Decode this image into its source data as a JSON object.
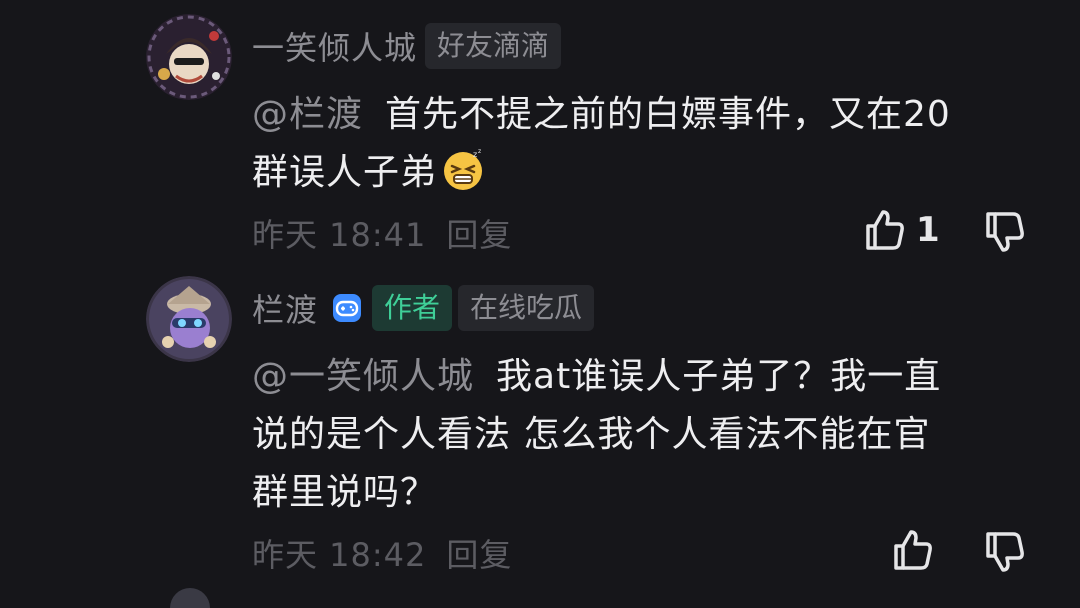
{
  "comments": [
    {
      "username": "一笑倾人城",
      "tags": [
        "好友滴滴"
      ],
      "mention": "@栏渡",
      "text_line1": "首先不提之前的白嫖事件，又在20",
      "text_line2": "群误人子弟",
      "emoji": "tired-face-emoji",
      "time": "昨天 18:41",
      "reply_label": "回复",
      "like_count": "1"
    },
    {
      "username": "栏渡",
      "badge": "game-controller-badge-icon",
      "author_tag": "作者",
      "tags": [
        "在线吃瓜"
      ],
      "mention": "@一笑倾人城",
      "text_line1": "我at谁误人子弟了？我一直",
      "text_line2": "说的是个人看法 怎么我个人看法不能在官",
      "text_line3": "群里说吗？",
      "time": "昨天 18:42",
      "reply_label": "回复",
      "like_count": ""
    }
  ],
  "colors": {
    "background": "#16161a",
    "muted_text": "#8d8d93",
    "author_tag": "#3fcf98",
    "badge_blue": "#3d8bff"
  }
}
